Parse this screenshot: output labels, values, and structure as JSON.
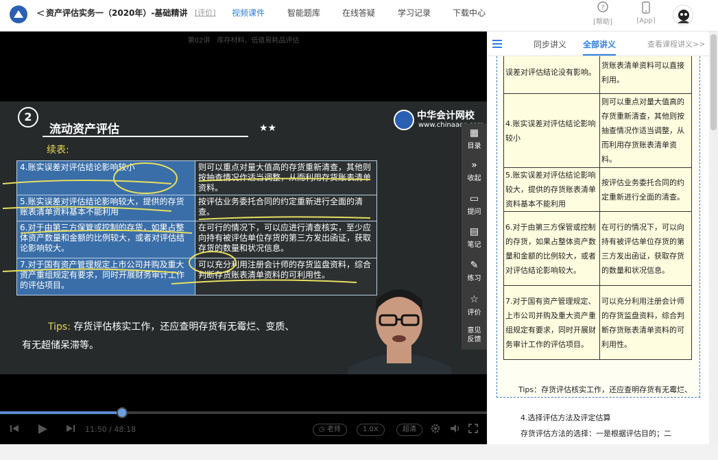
{
  "header": {
    "back_glyph": "<",
    "course_title": "资产评估实务一（2020年）-基础精讲",
    "review_label": "[评价]",
    "nav": [
      "视频课件",
      "智能题库",
      "在线答疑",
      "学习记录",
      "下载中心"
    ],
    "help_label": "[帮助]",
    "app_label": "[App]"
  },
  "video": {
    "lesson_title": "第02讲　库存材料、低值易耗品评估",
    "board": {
      "number": "2",
      "heading": "流动资产评估",
      "stars": "★★",
      "brand_name": "中华会计网校",
      "brand_url": "www.chinaacc.com",
      "subtitle": "续表:",
      "rows": [
        {
          "left": "4.账实误差对评估结论影响较小",
          "right": "则可以重点对量大值高的存货重新清查，其他则按抽查情况作适当调整，从而利用存货账表清单资料。"
        },
        {
          "left": "5.账实误差对评估结论影响较大，提供的存货账表清单资料基本不能利用",
          "right": "按评估业务委托合同的约定重新进行全面的清查。"
        },
        {
          "left": "6.对于由第三方保管或控制的存货，如果占整体资产数量和金额的比例较大，或者对评估结论影响较大。",
          "right": "在可行的情况下，可以应进行清查核实，至少应向持有被评估单位存货的第三方发出函证，获取存货的数量和状况信息。"
        },
        {
          "left": "7.对于国有资产管理规定上市公司并购及重大资产重组规定有要求，同时开展财务审计工作的评估项目。",
          "right": "可以充分利用注册会计师的存货监盘资料，综合判断存货账表清单资料的可利用性。"
        }
      ],
      "tips_label": "Tips:",
      "tips_line1": "存货评估核实工作，还应查明存货有无霉烂、变质、",
      "tips_line2": "有无超储呆滞等。"
    },
    "side_tools": [
      {
        "icon": "grid-icon",
        "glyph": "▦",
        "label": "目录"
      },
      {
        "icon": "collapse-icon",
        "glyph": "»",
        "label": "收起"
      },
      {
        "icon": "question-icon",
        "glyph": "▭",
        "label": "提问"
      },
      {
        "icon": "note-icon",
        "glyph": "▤",
        "label": "笔记"
      },
      {
        "icon": "practice-icon",
        "glyph": "✎",
        "label": "练习"
      },
      {
        "icon": "star-icon",
        "glyph": "☆",
        "label": "评价"
      },
      {
        "icon": "feedback-icon",
        "glyph": "",
        "label": "意见反馈"
      }
    ],
    "controls": {
      "progress": 0.25,
      "time_current": "11:50",
      "time_sep": "/",
      "time_total": "48:18",
      "teacher_label": "老师",
      "speed_label": "1.0X",
      "quality_label": "超清"
    }
  },
  "panel": {
    "tabs": [
      "同步讲义",
      "全部讲义"
    ],
    "view_link": "查看课程讲义>>",
    "notes_rows": [
      {
        "left": "误差对评估结论没有影响。",
        "right": "货账表清单资料可以直接利用。"
      },
      {
        "left": "4.账实误差对评估结论影响较小",
        "right": "则可以重点对量大值高的存货重新清查，其他则按抽查情况作适当调整，从而利用存货账表清单资料。"
      },
      {
        "left": "5.账实误差对评估结论影响较大，提供的存货账表清单资料基本不能利用",
        "right": "按评估业务委托合同的约定重新进行全面的清查。"
      },
      {
        "left": "6.对于由第三方保管或控制的存货，如果占整体资产数量和金额的比例较大，或者对评估结论影响较大。",
        "right": "在可行的情况下，可以向持有被评估单位存货的第三方发出函证，获取存货的数量和状况信息。"
      },
      {
        "left": "7.对于国有资产管理规定、上市公司并购及重大资产重组规定有要求，同时开展财务审计工作的评估项目。",
        "right": "可以充分利用注册会计师的存货监盘资料，综合判断存货账表清单资料的可利用性。"
      }
    ],
    "tips": "Tips：存货评估核实工作，还应查明存货有无霉烂、变质、毁损，有无超储呆滞等。",
    "next_heading": "4.选择评估方法及评定估算",
    "next_text": "存货评估方法的选择：一是根据评估目的；二"
  },
  "colors": {
    "accent": "#2d7fe0",
    "board_bg": "#262a2b",
    "board_cell": "#3a6ea8",
    "highlight": "#e8d85a",
    "notes_bg": "#fffde0"
  }
}
